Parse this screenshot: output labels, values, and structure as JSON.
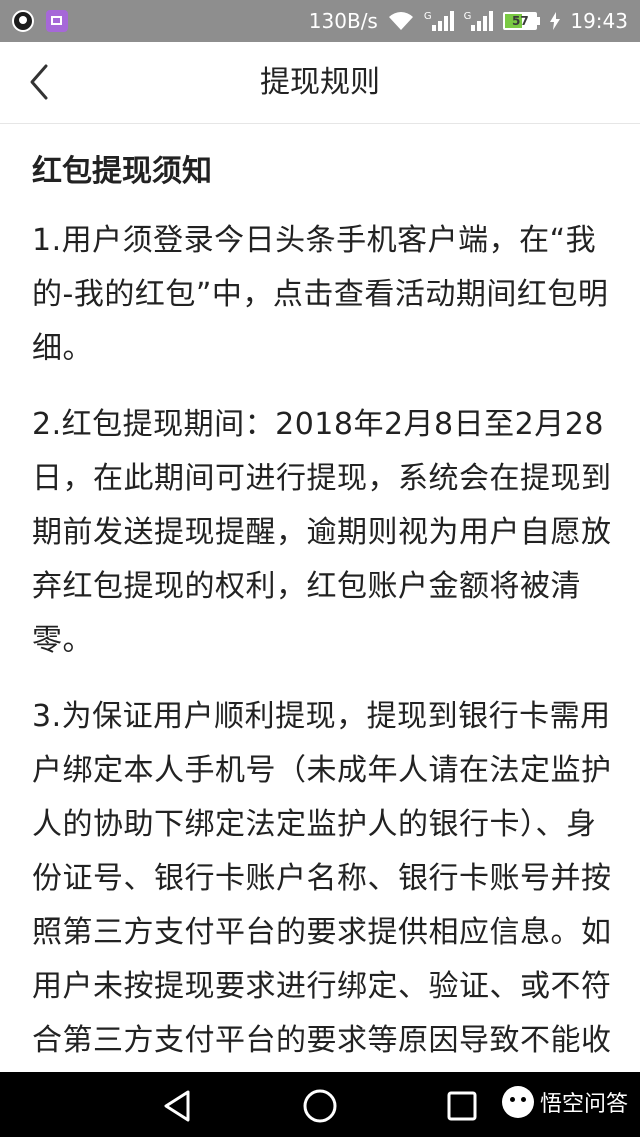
{
  "status_bar": {
    "speed": "130B/s",
    "sim1_label": "G",
    "sim2_label": "G",
    "battery_level": "57",
    "time": "19:43"
  },
  "header": {
    "back_icon": "chevron-left-icon",
    "title": "提现规则"
  },
  "content": {
    "section_title": "红包提现须知",
    "paragraphs": [
      "1.用户须登录今日头条手机客户端，在“我的-我的红包”中，点击查看活动期间红包明细。",
      "2.红包提现期间：2018年2月8日至2月28日，在此期间可进行提现，系统会在提现到期前发送提现提醒，逾期则视为用户自愿放弃红包提现的权利，红包账户金额将被清零。",
      "3.为保证用户顺利提现，提现到银行卡需用户绑定本人手机号（未成年人请在法定监护人的协助下绑定法定监护人的银行卡）、身份证号、银行卡账户名称、银行卡账号并按照第三方支付平台的要求提供相应信息。如用户未按提现要求进行绑定、验证、或不符合第三方支付平台的要求等原因导致不能收款（如未做实名认证或参加活动后与今日头"
    ]
  },
  "nav_bar": {
    "back_icon": "triangle-back-icon",
    "home_icon": "circle-home-icon",
    "recents_icon": "square-recents-icon",
    "watermark": "悟空问答"
  },
  "colors": {
    "status_bar_bg": "#8e8e8e",
    "nav_bar_bg": "#000000",
    "text": "#222222",
    "battery_fill": "#7ac943"
  }
}
